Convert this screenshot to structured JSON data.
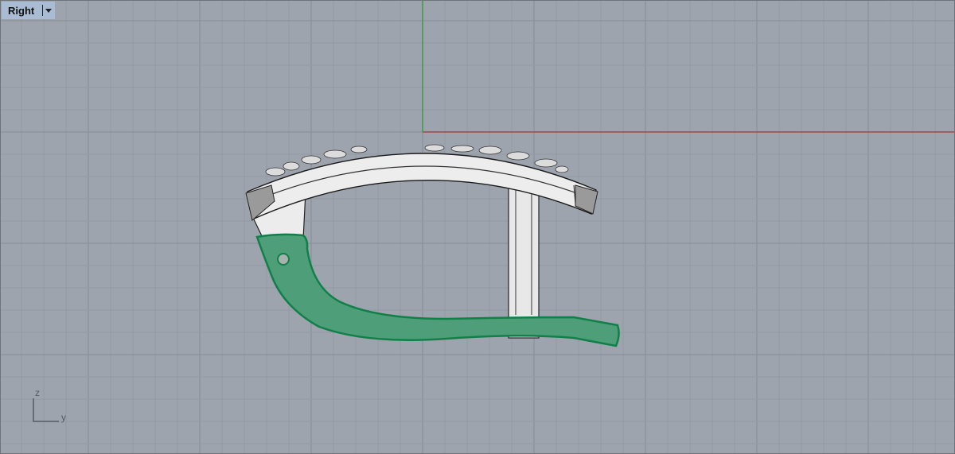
{
  "viewport": {
    "name": "Right",
    "axis_labels": {
      "vertical": "z",
      "horizontal": "y"
    }
  },
  "colors": {
    "background": "#9ea4ae",
    "grid_minor": "#929aa4",
    "grid_major": "#858c96",
    "x_axis": "#a04848",
    "y_axis": "#3f9a48",
    "handle": "#4e9e7a",
    "handle_edge": "#108048",
    "metal": "#ececec"
  }
}
